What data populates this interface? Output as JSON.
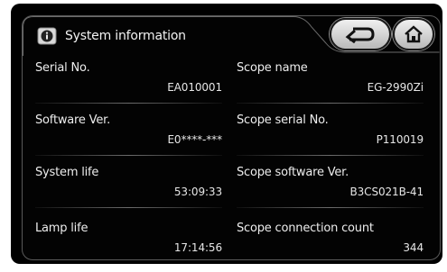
{
  "header": {
    "title": "System information"
  },
  "buttons": {
    "back_icon": "back-arrow-icon",
    "home_icon": "home-icon"
  },
  "fields": {
    "serial_no": {
      "label": "Serial No.",
      "value": "EA010001"
    },
    "scope_name": {
      "label": "Scope name",
      "value": "EG-2990Zi"
    },
    "software_ver": {
      "label": "Software Ver.",
      "value": "E0****-***"
    },
    "scope_serial_no": {
      "label": "Scope serial No.",
      "value": "P110019"
    },
    "system_life": {
      "label": "System life",
      "value": "53:09:33"
    },
    "scope_software_ver": {
      "label": "Scope software Ver.",
      "value": "B3CS021B-41"
    },
    "lamp_life": {
      "label": "Lamp life",
      "value": "17:14:56"
    },
    "scope_connection_count": {
      "label": "Scope connection count",
      "value": "344"
    }
  },
  "colors": {
    "background": "#000000",
    "text": "#ededed",
    "button": "#d8d8d8"
  }
}
